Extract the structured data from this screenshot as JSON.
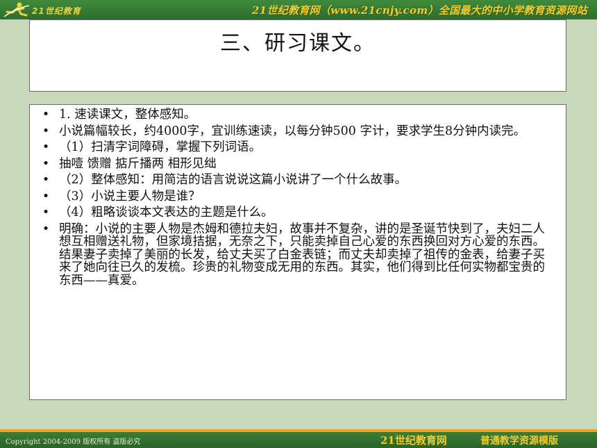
{
  "header": {
    "logo_text": "21世纪教育",
    "banner": "21世纪教育网（www.21cnjy.com）全国最大的中小学教育资源网站"
  },
  "slide": {
    "title": "三、研习课文。",
    "bullets": [
      "1. 速读课文，整体感知。",
      "小说篇幅较长，约4000字，宜训练速读，以每分钟500 字计，要求学生8分钟内读完。",
      "（1）扫清字词障碍，掌握下列词语。",
      "抽噎 馈赠 掂斤播两 相形见绌",
      "（2）整体感知：用简洁的语言说说这篇小说讲了一个什么故事。",
      "（3）小说主要人物是谁？",
      "（4）粗略谈谈本文表达的主题是什么。",
      "明确：小说的主要人物是杰姆和德拉夫妇，故事并不复杂，讲的是圣诞节快到了，夫妇二人想互相赠送礼物，但家境拮据，无奈之下，只能卖掉自己心爱的东西换回对方心爱的东西。结果妻子卖掉了美丽的长发，给丈夫买了白金表链；而丈夫却卖掉了祖传的金表，给妻子买来了她向往已久的发梳。珍贵的礼物变成无用的东西。其实，他们得到比任何实物都宝贵的东西——真爱。"
    ],
    "bullet_glyph": "•"
  },
  "footer": {
    "copyright": "Copyright 2004-2009 版权所有 盗版必究",
    "site": "21世纪教育网",
    "label": "普通教学资源模版"
  },
  "colors": {
    "band_green": "#2d6e2e",
    "accent_yellow": "#f2cc2d",
    "footer_orange": "#f0a21a",
    "background": "#c9d8ba"
  }
}
